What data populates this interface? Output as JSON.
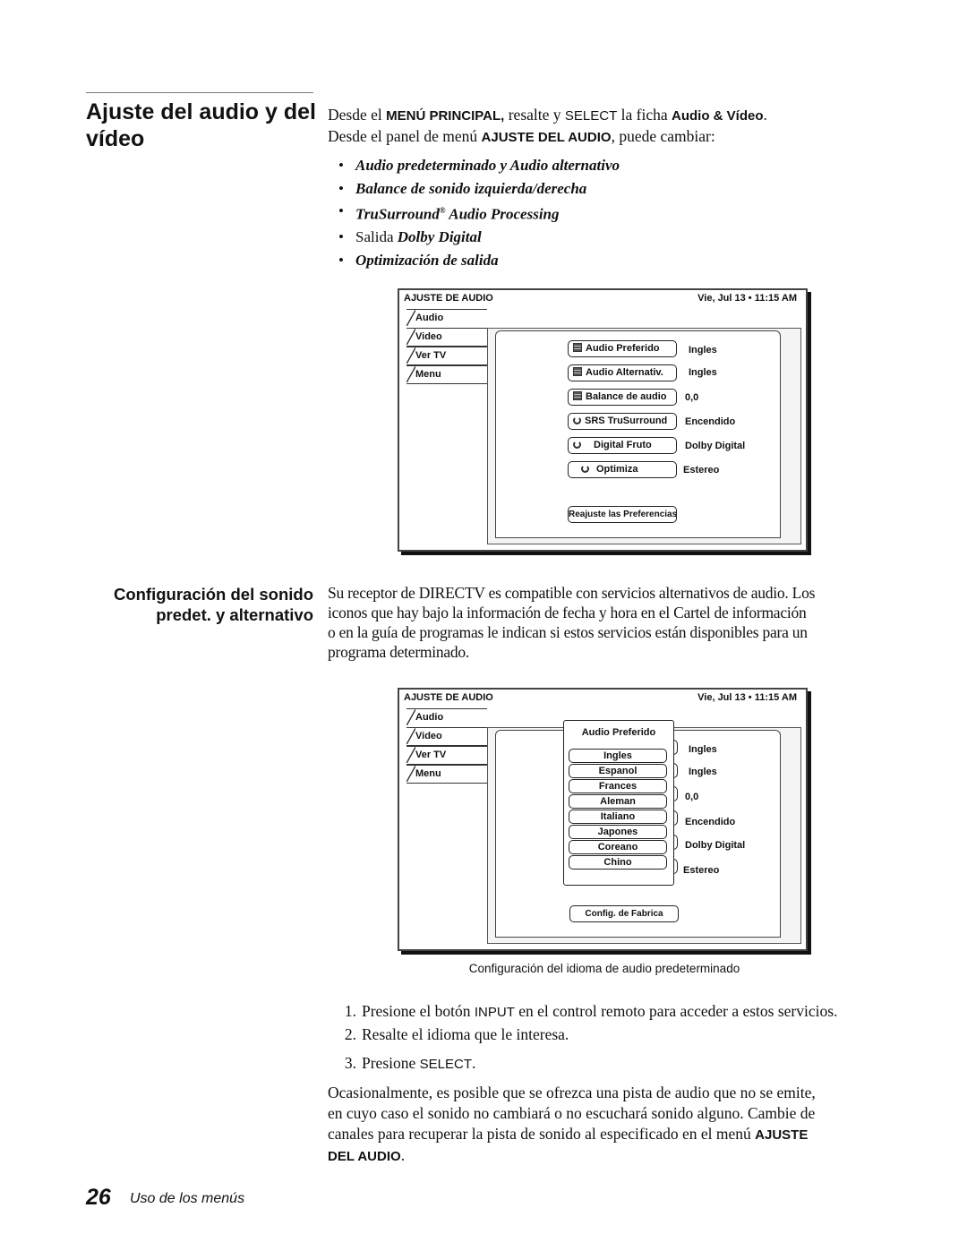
{
  "section1": {
    "heading": "Ajuste del audio y del vídeo",
    "intro_line1": [
      "Desde el ",
      "MENÚ PRINCIPAL,",
      " resalte y ",
      "SELECT",
      " la ficha ",
      "Audio & Vídeo",
      "."
    ],
    "intro_line2": [
      "Desde el panel de menú ",
      "AJUSTE DEL AUDIO",
      ", puede cambiar:"
    ],
    "bullets": [
      {
        "text": "Audio predeterminado y Audio alternativo"
      },
      {
        "text": "Balance de sonido izquierda/derecha"
      },
      {
        "text": "TruSurround",
        "sup": "®",
        "rest": " Audio Processing"
      },
      {
        "prefix": "Salida ",
        "text": "Dolby Digital"
      },
      {
        "text": "Optimización de salida"
      }
    ]
  },
  "screen1": {
    "title": "AJUSTE DE AUDIO",
    "datetime": "Vie, Jul 13 • 11:15 AM",
    "tabs": [
      "Audio",
      "Video",
      "Ver TV",
      "Menu"
    ],
    "settings": [
      {
        "label": "Audio Preferido",
        "icon": "list-icon",
        "value": "Ingles"
      },
      {
        "label": "Audio Alternativ.",
        "icon": "list-icon",
        "value": "Ingles"
      },
      {
        "label": "Balance de audio",
        "icon": "list-icon",
        "value": "0,0"
      },
      {
        "label": "SRS TruSurround",
        "icon": "cycle-icon",
        "value": "Encendido"
      },
      {
        "label": "Digital Fruto",
        "icon": "cycle-icon",
        "value": "Dolby Digital"
      },
      {
        "label": "Optimiza",
        "icon": "cycle-icon",
        "value": "Estereo"
      }
    ],
    "reset_button": "Reajuste las Preferencias"
  },
  "section2": {
    "heading_line1": "Configuración del sonido",
    "heading_line2": "predet. y alternativo",
    "paragraph": [
      "Su receptor de DIRECTV es compatible con servicios alternativos de audio. Los",
      "iconos que hay bajo la información de fecha y hora en el Cartel de información",
      "o en la guía de programas le indican si estos servicios están disponibles para un",
      "programa determinado."
    ]
  },
  "screen2": {
    "title": "AJUSTE DE AUDIO",
    "datetime": "Vie, Jul 13 • 11:15 AM",
    "tabs": [
      "Audio",
      "Video",
      "Ver TV",
      "Menu"
    ],
    "popup_title": "Audio Preferido",
    "options": [
      "Ingles",
      "Espanol",
      "Frances",
      "Aleman",
      "Italiano",
      "Japones",
      "Coreano",
      "Chino"
    ],
    "values": [
      "Ingles",
      "Ingles",
      "0,0",
      "Encendido",
      "Dolby Digital",
      "Estereo"
    ],
    "factory_button": "Config. de Fabrica"
  },
  "caption": "Configuración del idioma de audio predeterminado",
  "steps": [
    {
      "num": "1.",
      "parts": [
        "Presione el botón ",
        "INPUT",
        " en el control remoto para acceder a estos servicios."
      ]
    },
    {
      "num": "2.",
      "parts": [
        "Resalte el idioma que le interesa."
      ]
    },
    {
      "num": "3.",
      "parts": [
        "Presione ",
        "SELECT",
        "."
      ]
    }
  ],
  "closing": {
    "lines": [
      "Ocasionalmente, es posible que se ofrezca una pista de audio que no se emite,",
      "en cuyo caso el sonido no cambiará o no escuchará sonido alguno. Cambie de",
      "canales para recuperar la pista de sonido al especificado en el menú "
    ],
    "bold1": "AJUSTE",
    "bold2": "DEL AUDIO",
    "end": "."
  },
  "footer": {
    "page_number": "26",
    "section": "Uso de los menús"
  }
}
